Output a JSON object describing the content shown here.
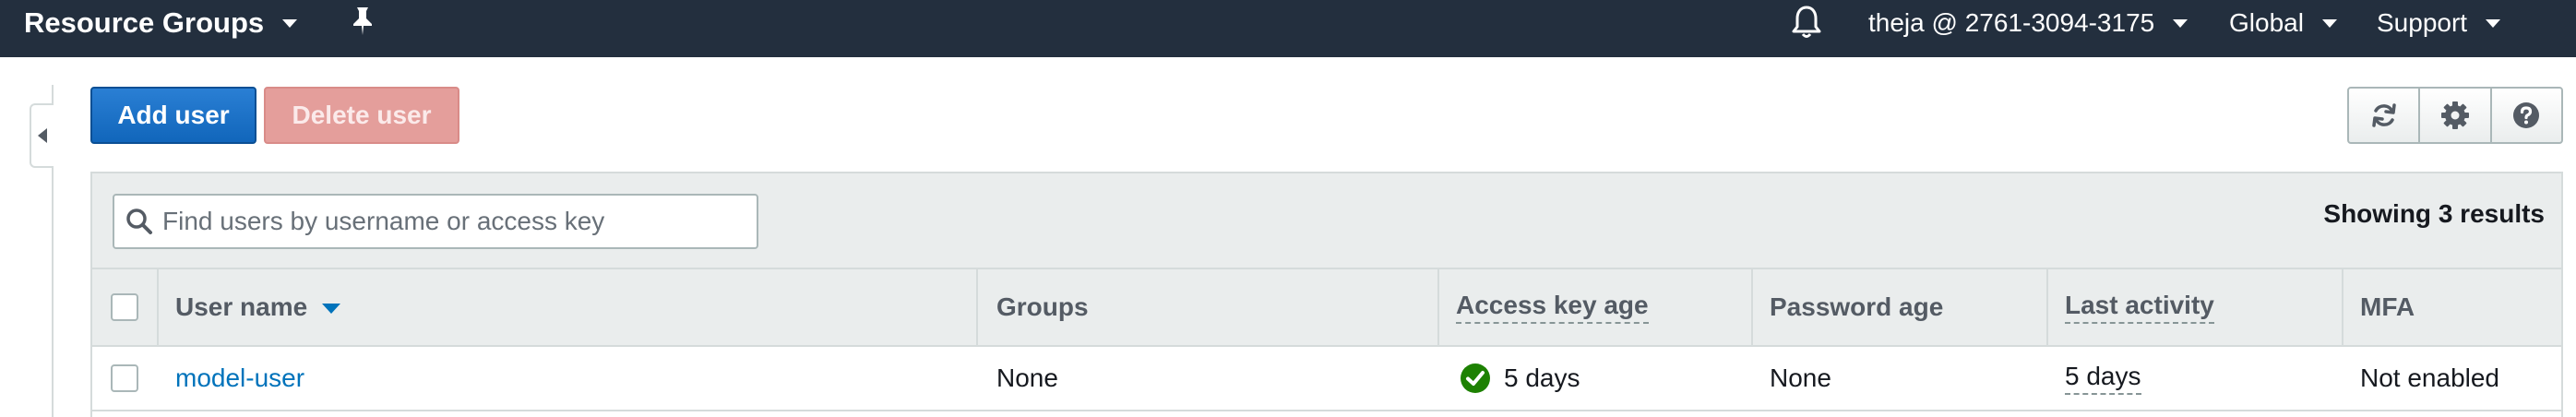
{
  "topbar": {
    "title": "Resource Groups",
    "account": "theja @ 2761-3094-3175",
    "region": "Global",
    "support": "Support",
    "icons": [
      "chevron-down-icon",
      "pin-icon",
      "bell-icon"
    ]
  },
  "toolbar": {
    "add_user": "Add user",
    "delete_user": "Delete user",
    "icons": [
      "refresh-icon",
      "gear-icon",
      "help-icon"
    ]
  },
  "search": {
    "placeholder": "Find users by username or access key",
    "value": ""
  },
  "results_text": "Showing 3 results",
  "table": {
    "columns": [
      "User name",
      "Groups",
      "Access key age",
      "Password age",
      "Last activity",
      "MFA"
    ],
    "sorted_by": "User name",
    "rows": [
      {
        "user_name": "model-user",
        "groups": "None",
        "access_key_age": "5 days",
        "access_key_status": "ok",
        "password_age": "None",
        "last_activity": "5 days",
        "mfa": "Not enabled"
      }
    ]
  },
  "colors": {
    "nav_bg": "#232f3e",
    "primary": "#1166bb",
    "danger_disabled": "#e49e9b",
    "link": "#0073bb",
    "success": "#1d8102",
    "header_bg": "#eaeded"
  }
}
